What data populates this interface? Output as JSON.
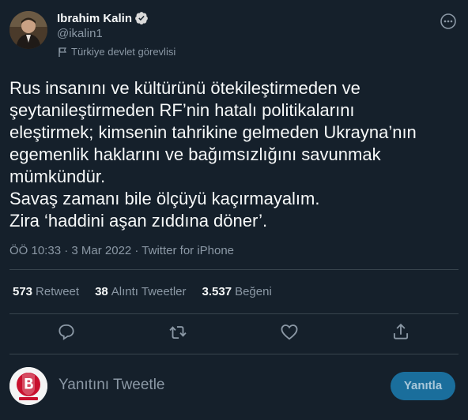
{
  "author": {
    "name": "Ibrahim Kalin",
    "handle": "@ikalin1",
    "label": "Türkiye devlet görevlisi"
  },
  "tweet": {
    "text": "Rus insanını ve kültürünü ötekileştirmeden ve\nşeytanileştirmeden RF’nin hatalı politikalarını\neleştirmek; kimsenin tahrikine gelmeden Ukrayna’nın\negemenlik haklarını ve bağımsızlığını savunmak\nmümkündür.\nSavaş zamanı bile ölçüyü kaçırmayalım.\nZira ‘haddini aşan zıddına döner’.",
    "meta": "ÖÖ 10:33 · 3 Mar 2022 · Twitter for iPhone"
  },
  "stats": {
    "retweets_count": "573",
    "retweets_label": "Retweet",
    "quotes_count": "38",
    "quotes_label": "Alıntı Tweetler",
    "likes_count": "3.537",
    "likes_label": "Beğeni"
  },
  "icons": {
    "verified": "verified-badge-icon",
    "label": "flag-icon",
    "more": "more-icon",
    "reply": "reply-icon",
    "retweet": "retweet-icon",
    "like": "heart-icon",
    "share": "share-icon"
  },
  "reply_box": {
    "placeholder": "Yanıtını Tweetle",
    "button_label": "Yanıtla"
  },
  "colors": {
    "background": "#15202b",
    "text": "#f7f9f9",
    "secondary": "#8b98a5",
    "accent": "#1d9bf0",
    "divider": "#38444d"
  }
}
